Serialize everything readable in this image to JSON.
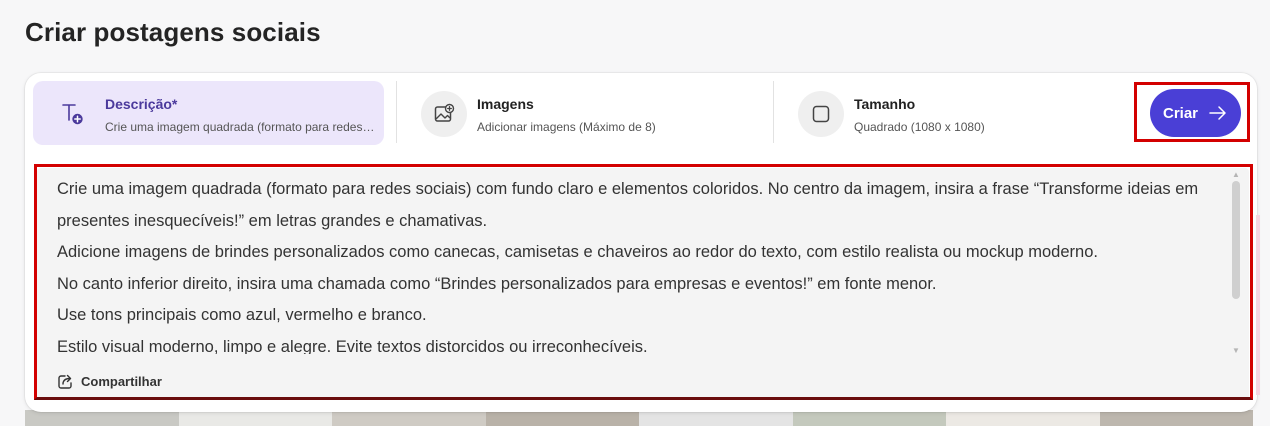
{
  "page": {
    "title": "Criar postagens sociais"
  },
  "options": [
    {
      "title": "Descrição*",
      "subtitle": "Crie uma imagem quadrada (formato para redes ...",
      "icon": "text-plus-icon"
    },
    {
      "title": "Imagens",
      "subtitle": "Adicionar imagens (Máximo de 8)",
      "icon": "image-add-icon"
    },
    {
      "title": "Tamanho",
      "subtitle": "Quadrado (1080 x 1080)",
      "icon": "square-icon"
    }
  ],
  "create_button": {
    "label": "Criar",
    "icon": "arrow-right-icon"
  },
  "prompt": {
    "lines": [
      "Crie uma imagem quadrada (formato para redes sociais) com fundo claro e elementos coloridos. No centro da imagem, insira a frase “Transforme ideias em presentes inesquecíveis!” em letras grandes e chamativas.",
      "Adicione imagens de brindes personalizados como canecas, camisetas e chaveiros ao redor do texto, com estilo realista ou mockup moderno.",
      "No canto inferior direito, insira uma chamada como “Brindes personalizados para empresas e eventos!” em fonte menor.",
      "Use tons principais como azul, vermelho e branco.",
      "Estilo visual moderno, limpo e alegre. Evite textos distorcidos ou irreconhecíveis."
    ]
  },
  "share": {
    "label": "Compartilhar",
    "icon": "share-icon"
  },
  "colors": {
    "accent": "#4a3fd6",
    "active_tab_bg": "#ece6fb",
    "annotation": "#d30000"
  }
}
